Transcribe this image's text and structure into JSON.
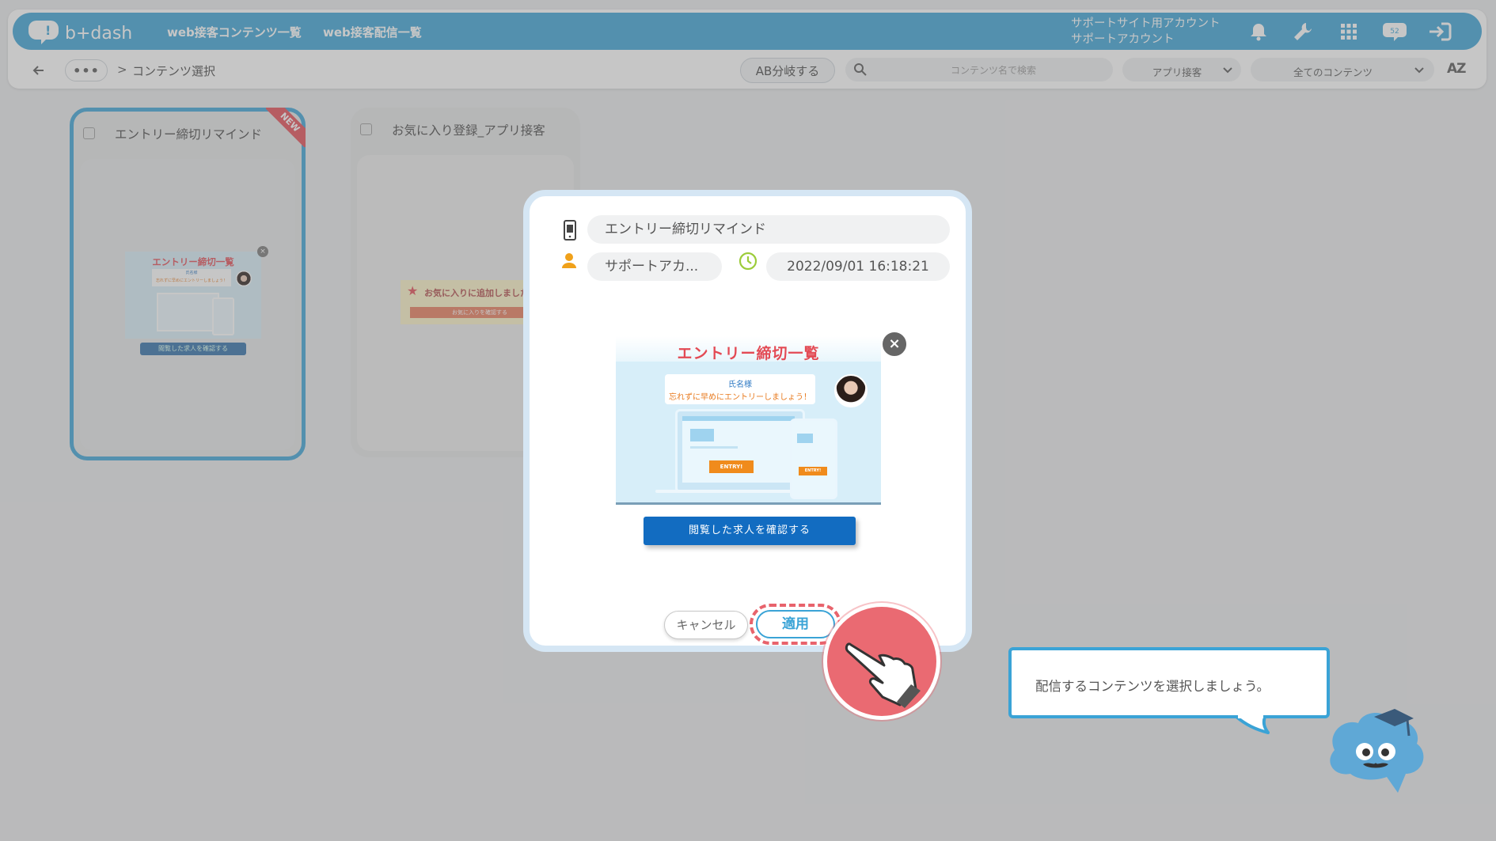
{
  "header": {
    "logo_text": "b+dash",
    "nav": [
      "web接客コンテンツ一覧",
      "web接客配信一覧"
    ],
    "account_line1": "サポートサイト用アカウント",
    "account_line2": "サポートアカウント",
    "notification_count": "52",
    "icons": [
      "bell-icon",
      "wrench-icon",
      "grid-icon",
      "chat-icon",
      "logout-icon"
    ]
  },
  "subbar": {
    "crumb_dots": "•••",
    "crumb_sep": ">",
    "crumb_current": "コンテンツ選択",
    "ab_button": "AB分岐する",
    "search_placeholder": "コンテンツ名で検索",
    "filter_type": "アプリ接客",
    "filter_scope": "全てのコンテンツ",
    "sort_label": "AZ"
  },
  "cards": [
    {
      "title": "エントリー締切リマインド",
      "badge": "NEW",
      "preview_title": "エントリー締切一覧",
      "preview_line1": "氏名様",
      "preview_line2": "忘れずに早めにエントリーしましょう！",
      "preview_button": "閲覧した求人を確認する"
    },
    {
      "title": "お気に入り登録_アプリ接客",
      "preview_text": "お気に入りに追加しました",
      "preview_button": "お気に入りを確認する"
    }
  ],
  "modal": {
    "content_name": "エントリー締切リマインド",
    "author": "サポートアカ...",
    "timestamp": "2022/09/01 16:18:21",
    "preview_title": "エントリー締切一覧",
    "preview_line1": "氏名様",
    "preview_line2": "忘れずに早めにエントリーしましょう！",
    "entry_label": "ENTRY!",
    "preview_button": "閲覧した求人を確認する",
    "close_label": "×",
    "cancel_label": "キャンセル",
    "apply_label": "適用"
  },
  "tutorial": {
    "message": "配信するコンテンツを選択しましょう。"
  },
  "colors": {
    "brand": "#3aa3d6",
    "highlight": "#e8636c",
    "cta": "#126cc1",
    "accent_red": "#e34a54"
  }
}
